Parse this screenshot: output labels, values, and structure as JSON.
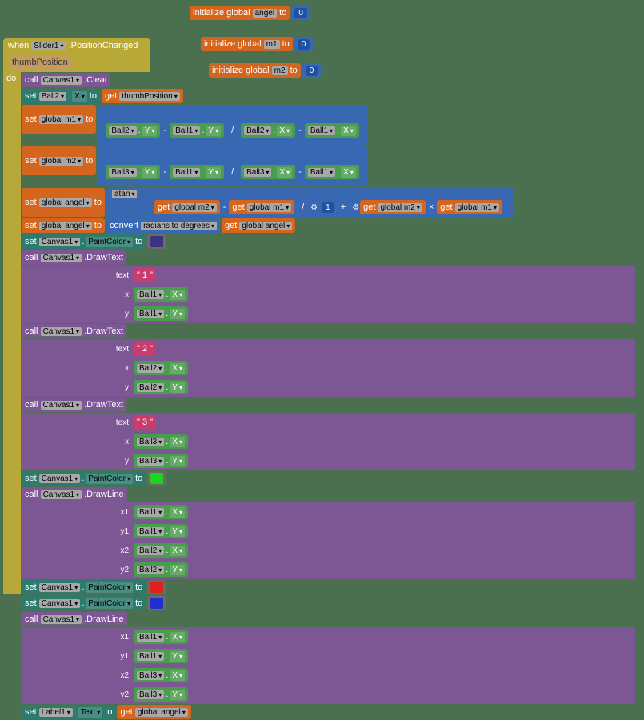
{
  "init": {
    "label": "initialize global",
    "to": "to",
    "vars": [
      "angel",
      "m1",
      "m2"
    ],
    "val": "0"
  },
  "when": {
    "kw": "when",
    "comp": "Slider1",
    "event": ".PositionChanged",
    "param": "thumbPosition",
    "do": "do"
  },
  "kw": {
    "call": "call",
    "set": "set",
    "get": "get",
    "to": "to",
    "convert": "convert",
    "atan": "atan"
  },
  "comp": {
    "canvas": "Canvas1",
    "ball1": "Ball1",
    "ball2": "Ball2",
    "ball3": "Ball3",
    "label1": "Label1"
  },
  "meth": {
    "clear": ".Clear",
    "drawtext": ".DrawText",
    "drawline": ".DrawLine"
  },
  "prop": {
    "x": "X",
    "y": "Y",
    "paintcolor": "PaintColor",
    "text": "Text"
  },
  "var": {
    "thumb": "thumbPosition",
    "gm1": "global m1",
    "gm2": "global m2",
    "gangel": "global angel"
  },
  "conv": "radians to degrees",
  "args": {
    "text": "text",
    "x": "x",
    "y": "y",
    "x1": "x1",
    "y1": "y1",
    "x2": "x2",
    "y2": "y2"
  },
  "lit": {
    "q1": "\" 1 \"",
    "q2": "\" 2 \"",
    "q3": "\" 3 \"",
    "one": "1"
  },
  "op": {
    "minus": "-",
    "div": "/",
    "plus": "+",
    "times": "×"
  }
}
